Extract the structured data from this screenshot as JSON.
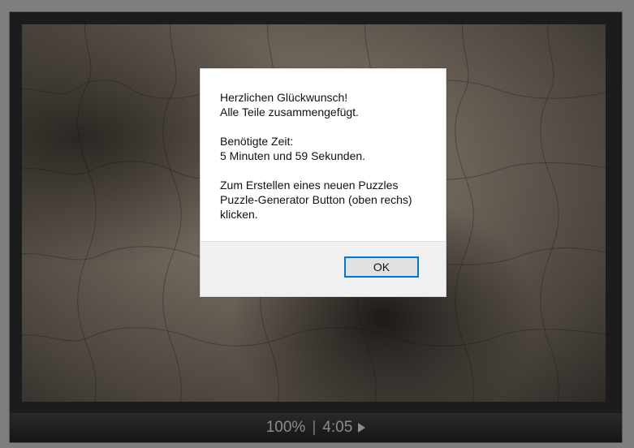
{
  "dialog": {
    "line1": "Herzlichen Glückwunsch!",
    "line2": "Alle Teile zusammengefügt.",
    "time_label": "Benötigte Zeit:",
    "time_value": "5 Minuten und 59 Sekunden.",
    "hint_line1": "Zum Erstellen eines neuen Puzzles",
    "hint_line2": "Puzzle-Generator Button (oben rechs)",
    "hint_line3": "klicken.",
    "ok_label": "OK"
  },
  "status": {
    "zoom": "100%",
    "separator": "|",
    "time": "4:05",
    "play_icon": "play-icon"
  },
  "colors": {
    "dialog_button_border": "#0078d7",
    "status_text": "#8c8c8c"
  }
}
